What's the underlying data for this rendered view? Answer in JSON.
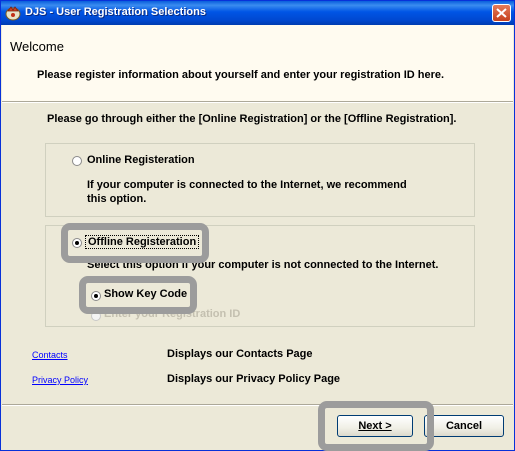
{
  "window": {
    "title": "DJS - User Registration Selections"
  },
  "header": {
    "title": "Welcome",
    "description": "Please register information about yourself and enter your registration ID here."
  },
  "instructions": "Please go through either the [Online Registration] or the [Offline Registration].",
  "online": {
    "label": "Online Registeration",
    "description": "If your computer is connected to the Internet, we recommend this option.",
    "selected": false
  },
  "offline": {
    "label": "Offline Registeration",
    "description": "Select this option if your computer is not connected to the Internet.",
    "selected": true,
    "show_key": {
      "label": "Show Key Code",
      "selected": true
    },
    "enter_id": {
      "label": "Enter your Registration ID",
      "selected": false,
      "enabled": false
    }
  },
  "links": [
    {
      "label": "Contacts",
      "description": "Displays our Contacts Page"
    },
    {
      "label": "Privacy Policy",
      "description": "Displays our Privacy Policy Page"
    }
  ],
  "buttons": {
    "next": "Next >",
    "cancel": "Cancel"
  },
  "colors": {
    "titlebar": "#0055e5",
    "dialog": "#ece9d8",
    "link": "#0000ff",
    "highlight": "#9c9c9c"
  }
}
